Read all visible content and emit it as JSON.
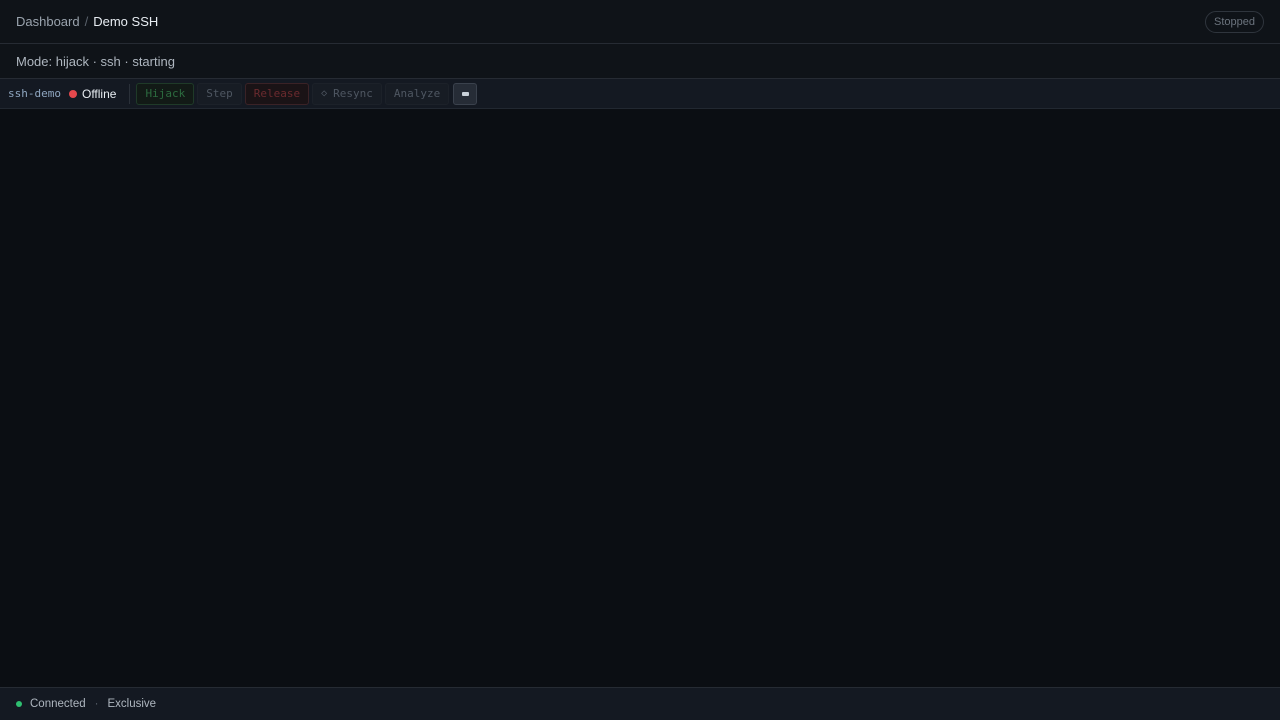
{
  "header": {
    "breadcrumb": {
      "parent": "Dashboard",
      "separator": "/",
      "current": "Demo SSH"
    },
    "status_badge": "Stopped"
  },
  "modebar": {
    "text": "Mode: hijack · ssh · starting"
  },
  "toolbar": {
    "session_name": "ssh-demo",
    "connection": {
      "label": "Offline",
      "color": "#e5484d"
    },
    "buttons": {
      "hijack": "Hijack",
      "step": "Step",
      "release": "Release",
      "resync_icon": "◇",
      "resync": "Resync",
      "analyze": "Analyze"
    },
    "keyboard_icon": "keyboard-icon"
  },
  "footer": {
    "connection": {
      "label": "Connected",
      "color": "#2fbf71"
    },
    "separator": "·",
    "mode": "Exclusive"
  }
}
